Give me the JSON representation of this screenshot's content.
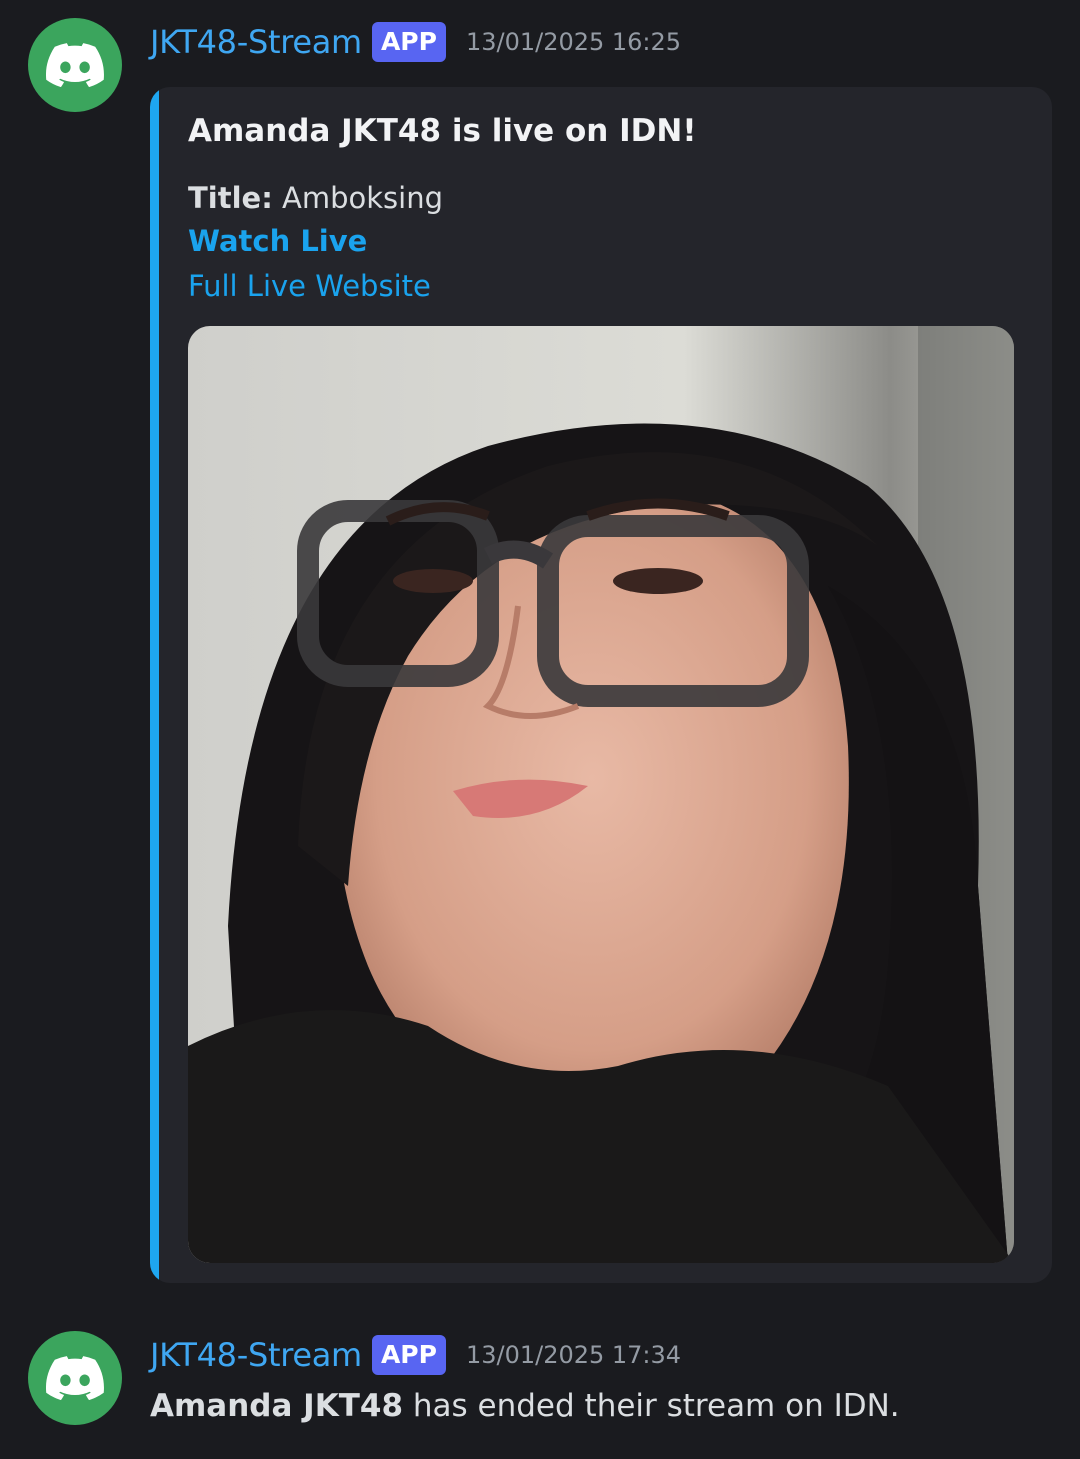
{
  "messages": [
    {
      "author": "JKT48-Stream",
      "badge": "APP",
      "timestamp": "13/01/2025 16:25",
      "avatar_icon": "discord-logo-icon",
      "embed": {
        "accent_color": "#1ea6f0",
        "title": "Amanda JKT48 is live on IDN!",
        "field_name": "Title:",
        "field_value": "Amboksing",
        "watch_live_label": "Watch Live",
        "full_live_label": "Full Live Website",
        "image": "selfie-photo"
      }
    },
    {
      "author": "JKT48-Stream",
      "badge": "APP",
      "timestamp": "13/01/2025 17:34",
      "avatar_icon": "discord-logo-icon",
      "text_bold": "Amanda JKT48",
      "text_rest": " has ended their stream on IDN."
    }
  ],
  "colors": {
    "background": "#1a1b1f",
    "username": "#3fa7f2",
    "badge": "#5865f2",
    "link": "#1aa3ee",
    "avatar": "#3ba55d"
  }
}
